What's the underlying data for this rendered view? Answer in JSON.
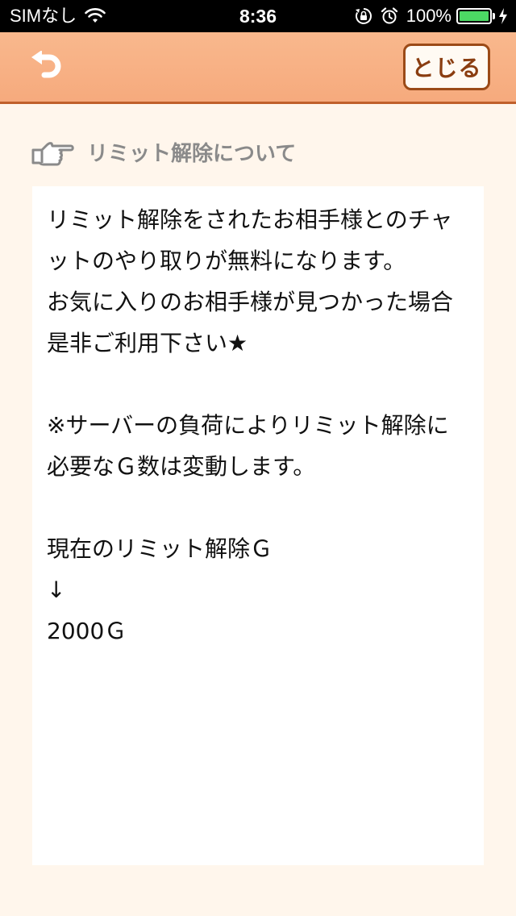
{
  "status_bar": {
    "carrier": "SIMなし",
    "time": "8:36",
    "battery_percent": "100%",
    "battery_level": 1.0,
    "battery_color": "#4cd964"
  },
  "nav": {
    "back_icon": "back-arrow-icon",
    "close_label": "とじる",
    "background_color": "#f6aa7d"
  },
  "section": {
    "icon": "pointing-hand-icon",
    "title": "リミット解除について"
  },
  "content": {
    "body": "リミット解除をされたお相手様とのチャットのやり取りが無料になります。\nお気に入りのお相手様が見つかった場合是非ご利用下さい★\n\n※サーバーの負荷によりリミット解除に必要なＧ数は変動します。\n\n現在のリミット解除Ｇ\n↓\n2000Ｇ"
  }
}
